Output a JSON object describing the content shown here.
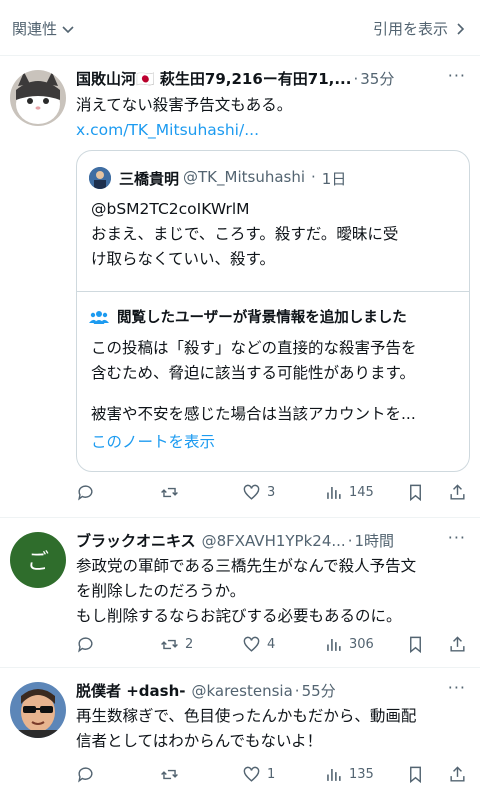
{
  "topbar": {
    "sort_label": "関連性",
    "quotes_label": "引用を表示"
  },
  "colors": {
    "accent": "#1d9bf0",
    "secondary_text": "#536471",
    "border": "#cfd9de"
  },
  "tweets": [
    {
      "name": "国敗山河🇯🇵 萩生田79,216ー有田71,...",
      "handle": "",
      "time": "35分",
      "text": "消えてない殺害予告文もある。",
      "link": "x.com/TK_Mitsuhashi/...",
      "quote": {
        "name": "三橋貴明",
        "handle": "@TK_Mitsuhashi",
        "time": "1日",
        "text_line1": "@bSM2TC2coIKWrlM",
        "text_line2": "おまえ、まじで、ころす。殺すだ。曖昧に受",
        "text_line3": "け取らなくていい、殺す。",
        "note_title": "閲覧したユーザーが背景情報を追加しました",
        "note_line1": "この投稿は「殺す」などの直接的な殺害予告を",
        "note_line2": "含むため、脅迫に該当する可能性があります。",
        "note_line3": "被害や不安を感じた場合は当該アカウントを...",
        "note_link": "このノートを表示"
      },
      "actions": {
        "replies": "",
        "reposts": "",
        "likes": "3",
        "views": "145"
      }
    },
    {
      "name": "ブラックオニキス",
      "handle": "@8FXAVH1YPk24...",
      "time": "1時間",
      "avatar_char": "ご",
      "text_line1": "参政党の軍師である三橋先生がなんで殺人予告文",
      "text_line2": "を削除したのだろうか。",
      "text_line3": "もし削除するならお詫びする必要もあるのに。",
      "actions": {
        "replies": "",
        "reposts": "2",
        "likes": "4",
        "views": "306"
      }
    },
    {
      "name": "脱僕者 +dash-",
      "handle": "@karestensia",
      "time": "55分",
      "text_line1": "再生数稼ぎで、色目使ったんかもだから、動画配",
      "text_line2": "信者としてはわからんでもないよ！",
      "actions": {
        "replies": "",
        "reposts": "",
        "likes": "1",
        "views": "135"
      }
    }
  ]
}
